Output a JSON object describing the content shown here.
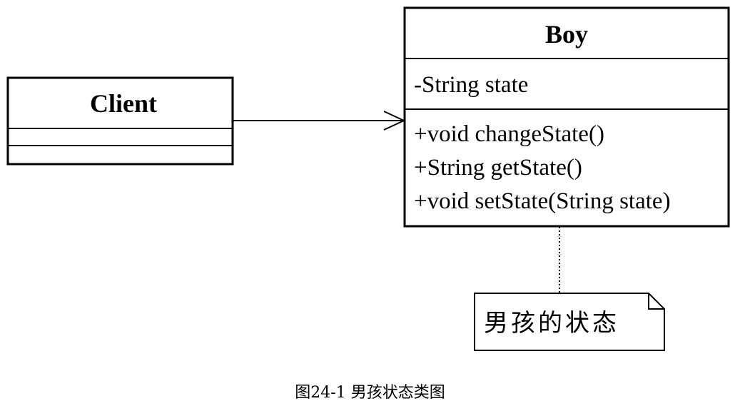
{
  "classes": {
    "client": {
      "name": "Client",
      "attributes": [],
      "operations": []
    },
    "boy": {
      "name": "Boy",
      "attributes": [
        "-String state"
      ],
      "operations": [
        "+void changeState()",
        "+String getState()",
        "+void setState(String state)"
      ]
    }
  },
  "note": {
    "text": "男孩的状态"
  },
  "caption": "图24-1 男孩状态类图"
}
